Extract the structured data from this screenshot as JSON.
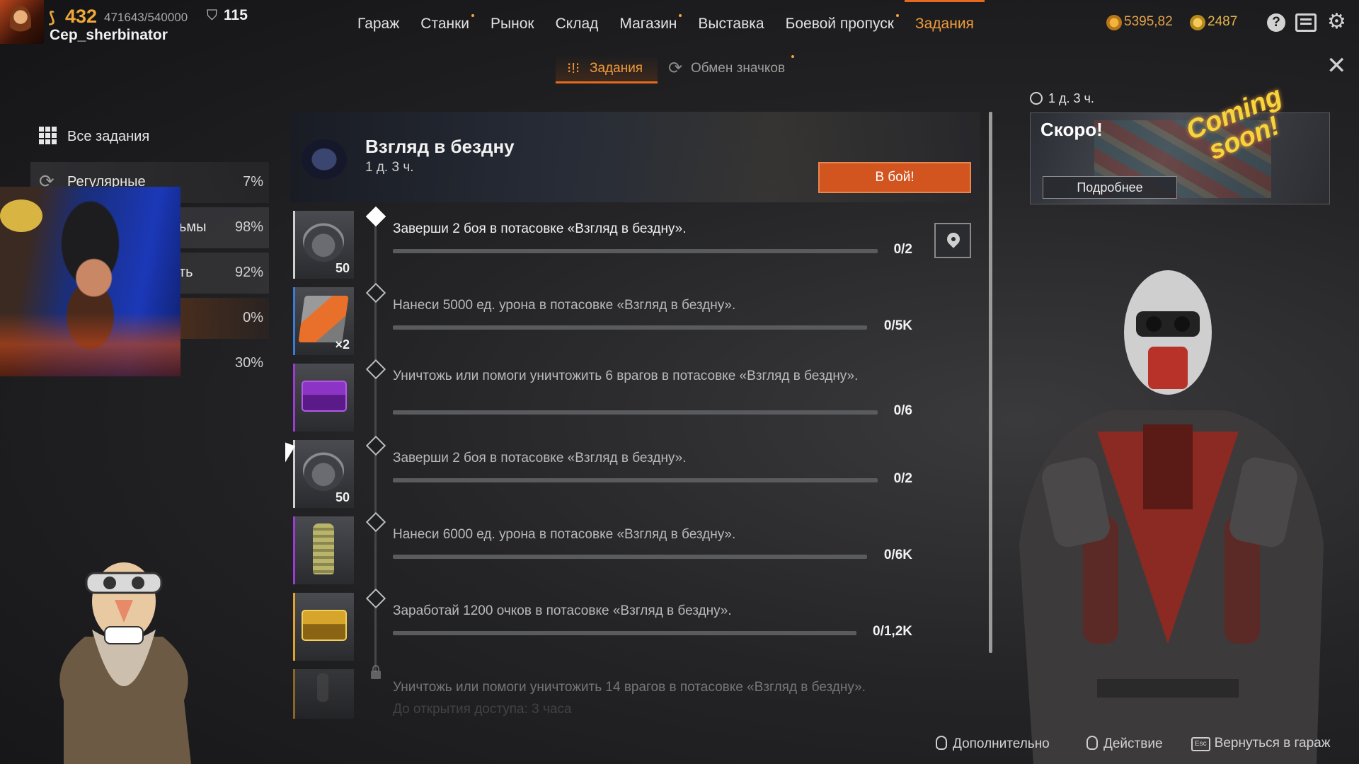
{
  "player": {
    "level": "432",
    "xp": "471643/540000",
    "rating": "115",
    "username": "Cep_sherbinator"
  },
  "nav": {
    "items": [
      {
        "label": "Гараж",
        "dot": false,
        "active": false
      },
      {
        "label": "Станки",
        "dot": true,
        "active": false
      },
      {
        "label": "Рынок",
        "dot": false,
        "active": false
      },
      {
        "label": "Склад",
        "dot": false,
        "active": false
      },
      {
        "label": "Магазин",
        "dot": true,
        "active": false
      },
      {
        "label": "Выставка",
        "dot": false,
        "active": false
      },
      {
        "label": "Боевой пропуск",
        "dot": true,
        "active": false
      },
      {
        "label": "Задания",
        "dot": false,
        "active": true
      }
    ]
  },
  "currencies": {
    "coins": "5395,82",
    "badges": "2487"
  },
  "subtabs": {
    "quests": "Задания",
    "badge_exchange": "Обмен значков"
  },
  "sidebar": {
    "items": [
      {
        "label": "Все задания",
        "pct": ""
      },
      {
        "label": "Регулярные",
        "pct": "7%"
      },
      {
        "label": "ьмы",
        "pct": "98%"
      },
      {
        "label": "ть",
        "pct": "92%"
      },
      {
        "label": "",
        "pct": "0%"
      },
      {
        "label": "",
        "pct": "30%"
      }
    ]
  },
  "event": {
    "title": "Взгляд в бездну",
    "timer": "1 д. 3 ч.",
    "battle_button": "В бой!"
  },
  "quests": [
    {
      "text": "Заверши 2 боя в потасовке «Взгляд в бездну».",
      "progress": "0/2",
      "count": "50",
      "icon": "gear-icon",
      "stripe": "#cfcfcf"
    },
    {
      "text": "Нанеси 5000 ед. урона в потасовке «Взгляд в бездну».",
      "progress": "0/5K",
      "count": "×2",
      "icon": "armor-plate-icon",
      "stripe": "#3a7bd5"
    },
    {
      "text": "Уничтожь или помоги уничтожить 6 врагов в потасовке «Взгляд в бездну».",
      "progress": "0/6",
      "count": "",
      "icon": "purple-chest-icon",
      "stripe": "#9b3ad5"
    },
    {
      "text": "Заверши 2 боя в потасовке «Взгляд в бездну».",
      "progress": "0/2",
      "count": "50",
      "icon": "gear-icon",
      "stripe": "#cfcfcf"
    },
    {
      "text": "Нанеси 6000 ед. урона в потасовке «Взгляд в бездну».",
      "progress": "0/6K",
      "count": "",
      "icon": "canister-icon",
      "stripe": "#9b3ad5"
    },
    {
      "text": "Заработай 1200 очков в потасовке «Взгляд в бездну».",
      "progress": "0/1,2K",
      "count": "",
      "icon": "gold-chest-icon",
      "stripe": "#e0a22a"
    },
    {
      "text": "Уничтожь или помоги уничтожить 14 врагов в потасовке «Взгляд в бездну».",
      "progress": "",
      "count": "",
      "icon": "figure-icon",
      "stripe": "#e0a22a",
      "locked_note": "До открытия доступа: 3 часа"
    }
  ],
  "promo": {
    "timer": "1 д. 3 ч.",
    "title": "Скоро!",
    "coming_soon_line1": "Coming",
    "coming_soon_line2": "soon!",
    "button": "Подробнее"
  },
  "footer": {
    "more": "Дополнительно",
    "action": "Действие",
    "back": "Вернуться в гараж",
    "esc": "Esc"
  },
  "colors": {
    "accent": "#e36a1e",
    "active_tab": "#f29a3a",
    "battle_button": "#d2541f"
  }
}
